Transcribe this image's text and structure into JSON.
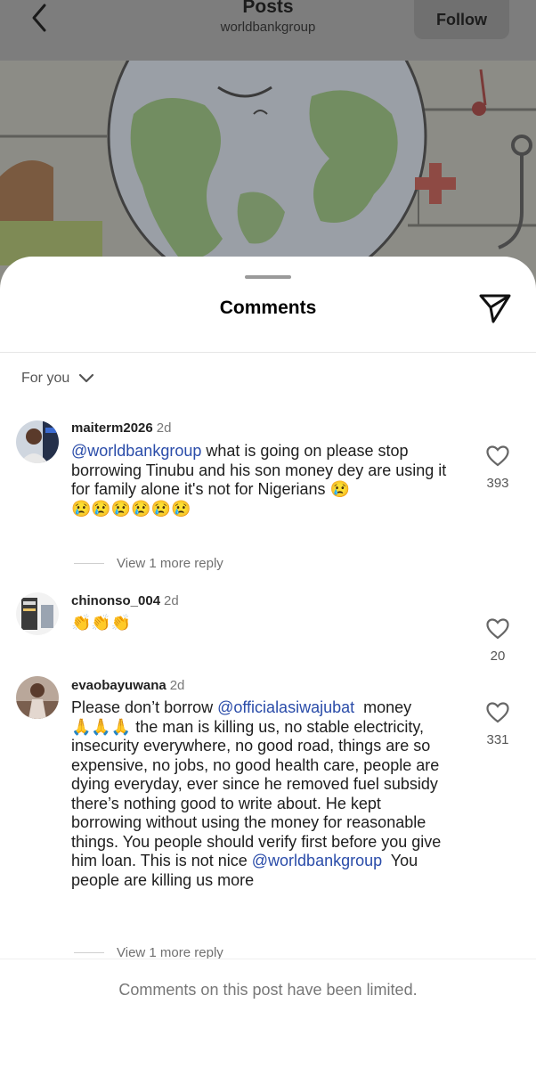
{
  "header": {
    "title": "Posts",
    "subtitle": "worldbankgroup",
    "follow_label": "Follow"
  },
  "sheet": {
    "title": "Comments",
    "sort_label": "For you"
  },
  "comments": [
    {
      "username": "maiterm2026",
      "time": "2d",
      "mention": "@worldbankgroup",
      "text": " what is going on please stop borrowing Tinubu and his son money dey are using it for family alone it's not for Nigerians 😢\n😢😢😢😢😢😢",
      "likes": "393",
      "view_replies": "View 1 more reply"
    },
    {
      "username": "chinonso_004",
      "time": "2d",
      "text": "👏👏👏",
      "likes": "20"
    },
    {
      "username": "evaobayuwana",
      "time": "2d",
      "text_a": "Please don’t borrow ",
      "mention_a": "@officialasiwajubat",
      "text_b": "  money\n🙏🙏🙏 the man is killing us, no stable electricity, insecurity everywhere, no good road, things are so expensive, no jobs, no good health care, people are dying everyday, ever since he removed fuel subsidy there’s nothing good to write about. He kept borrowing without using the money for reasonable things. You people should verify first before you give him loan. This is not nice ",
      "mention_b": "@worldbankgroup",
      "text_c": "  You people are killing us more",
      "likes": "331",
      "view_replies": "View 1 more reply"
    }
  ],
  "footer": {
    "notice": "Comments on this post have been limited."
  }
}
